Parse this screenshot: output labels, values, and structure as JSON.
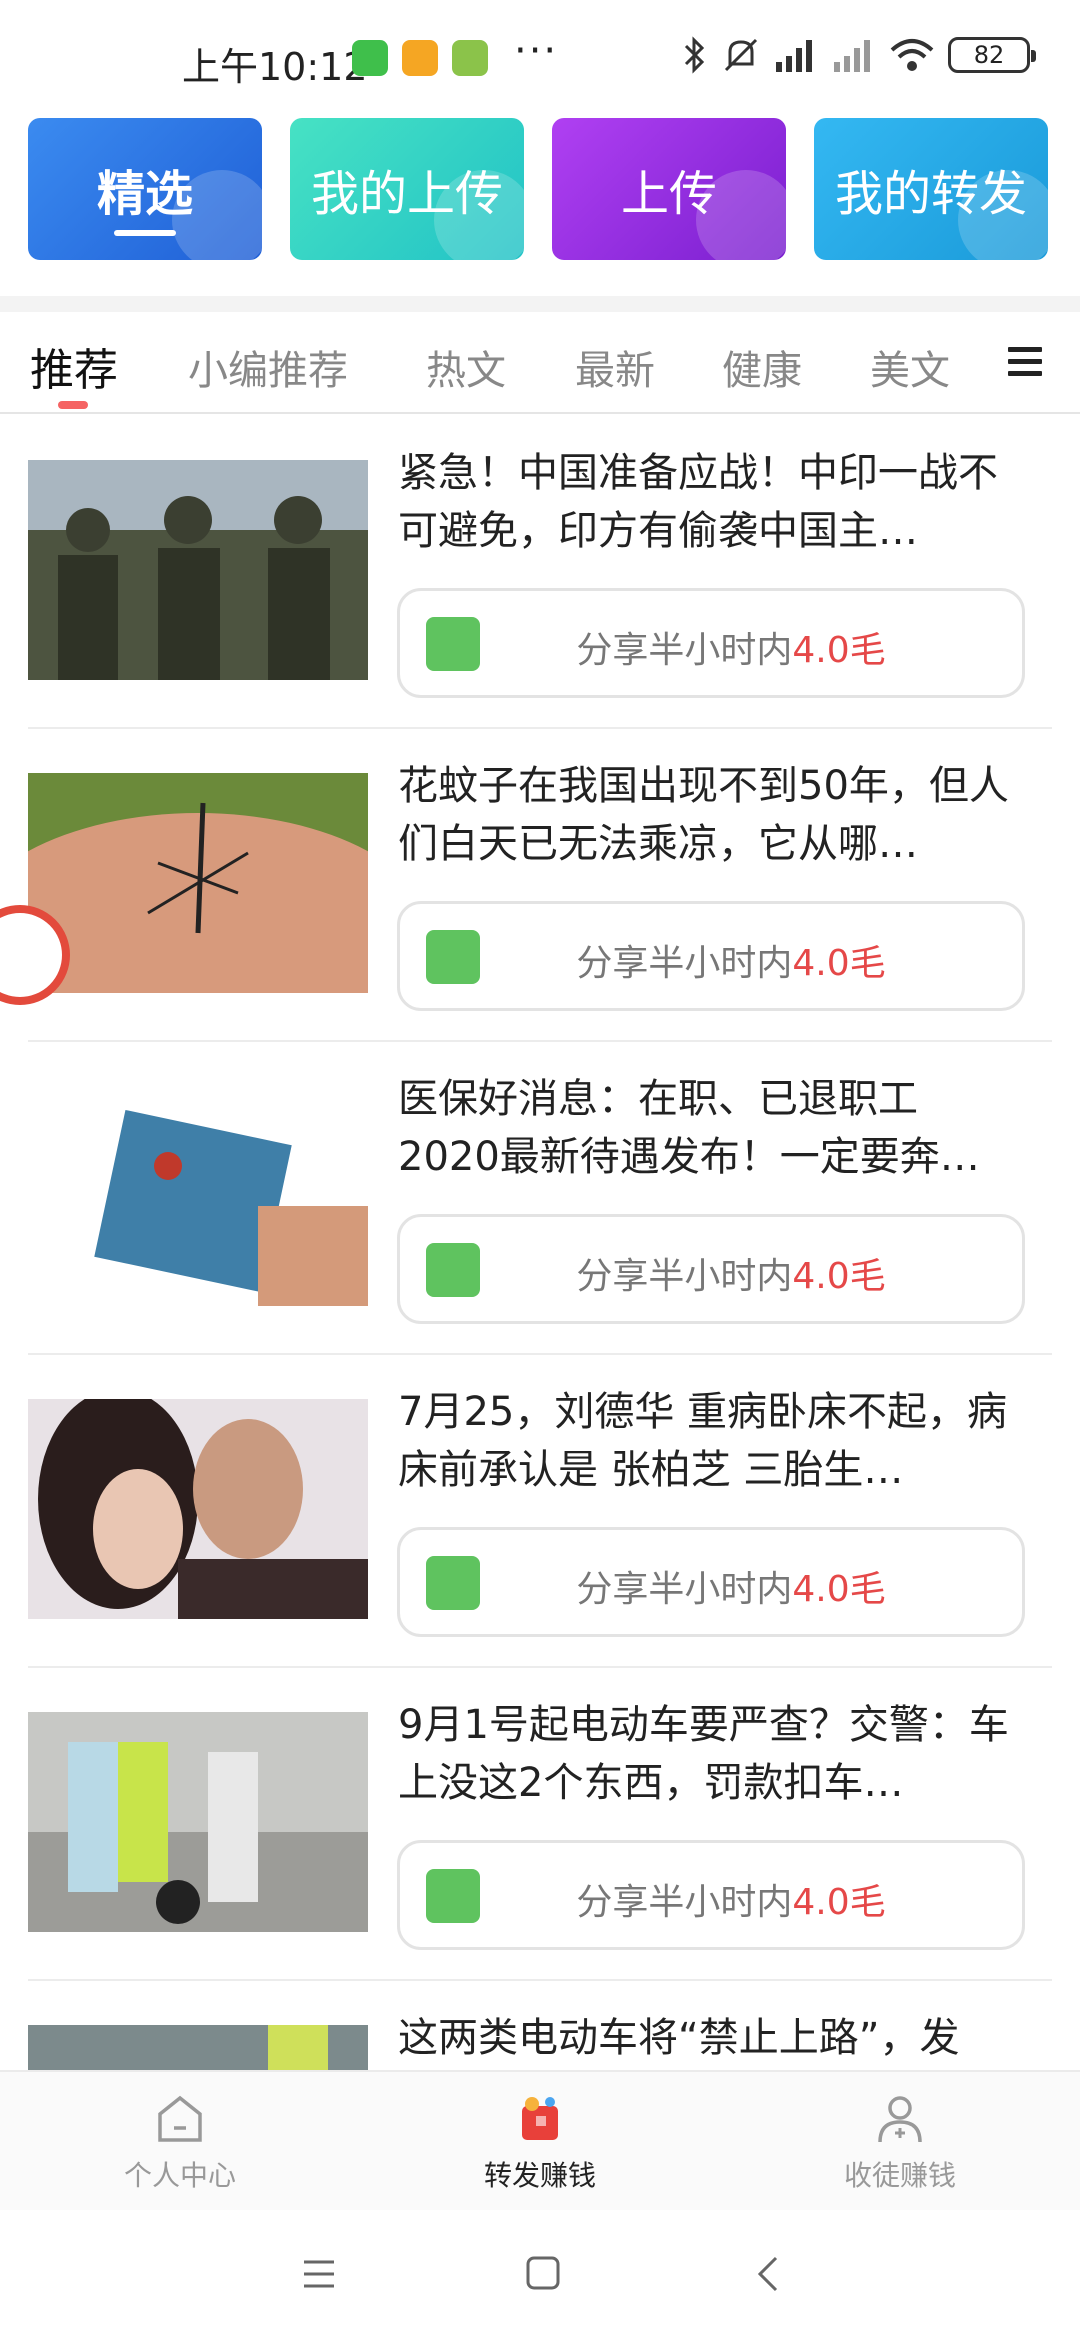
{
  "status_bar": {
    "time": "上午10:12",
    "dots": "···",
    "battery": "82"
  },
  "top_cards": [
    {
      "label": "精选",
      "color": "#2f7ae8"
    },
    {
      "label": "我的上传",
      "color": "#2fd1c0"
    },
    {
      "label": "上传",
      "color": "#9a2fe0"
    },
    {
      "label": "我的转发",
      "color": "#27a8ea"
    }
  ],
  "tabs": [
    "推荐",
    "小编推荐",
    "热文",
    "最新",
    "健康",
    "美文"
  ],
  "articles": [
    {
      "title": "紧急！中国准备应战！中印一战不可避免，印方有偷袭中国主…",
      "share_prefix": "分享半小时内",
      "share_amount": "4.0毛",
      "thumb": "soldiers"
    },
    {
      "title": "花蚊子在我国出现不到50年，但人们白天已无法乘凉，它从哪…",
      "share_prefix": "分享半小时内",
      "share_amount": "4.0毛",
      "thumb": "mosquito"
    },
    {
      "title": "医保好消息：在职、已退职工2020最新待遇发布！一定要奔…",
      "share_prefix": "分享半小时内",
      "share_amount": "4.0毛",
      "thumb": "card"
    },
    {
      "title": "7月25，刘德华 重病卧床不起，病床前承认是 张柏芝 三胎生…",
      "share_prefix": "分享半小时内",
      "share_amount": "4.0毛",
      "thumb": "couple"
    },
    {
      "title": "9月1号起电动车要严查？交警：车上没这2个东西，罚款扣车…",
      "share_prefix": "分享半小时内",
      "share_amount": "4.0毛",
      "thumb": "police"
    },
    {
      "title": "这两类电动车将“禁止上路”，发",
      "share_prefix": "",
      "share_amount": "",
      "thumb": "street"
    }
  ],
  "bottom_nav": [
    {
      "label": "个人中心",
      "icon": "home-icon",
      "active": false
    },
    {
      "label": "转发赚钱",
      "icon": "gift-icon",
      "active": true
    },
    {
      "label": "收徒赚钱",
      "icon": "user-add-icon",
      "active": false
    }
  ],
  "colors": {
    "accent_red": "#e54848",
    "wechat_green": "#5fc35f"
  }
}
